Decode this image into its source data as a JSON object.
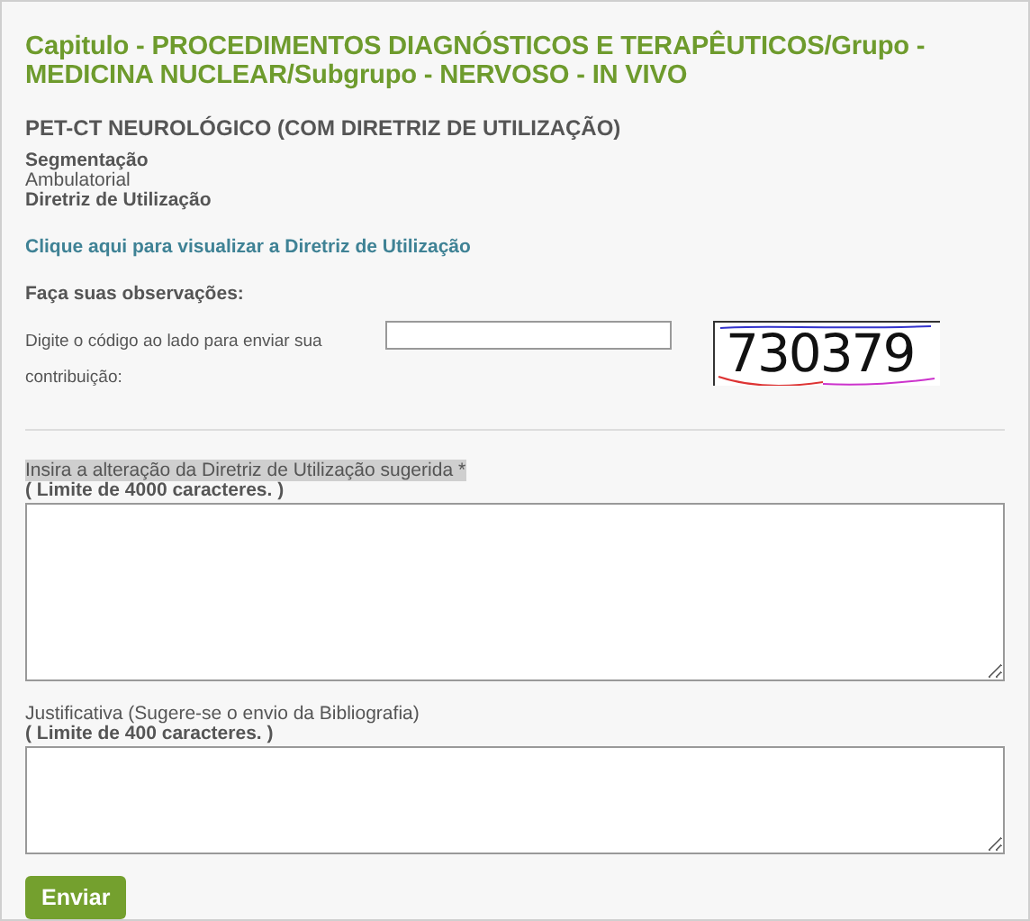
{
  "heading": "Capitulo - PROCEDIMENTOS DIAGNÓSTICOS E TERAPÊUTICOS/Grupo - MEDICINA NUCLEAR/Subgrupo - NERVOSO - IN VIVO",
  "procedure": "PET-CT NEUROLÓGICO (COM DIRETRIZ DE UTILIZAÇÃO)",
  "details": [
    {
      "kind": "label",
      "text": "Segmentação"
    },
    {
      "kind": "value",
      "text": "Ambulatorial"
    },
    {
      "kind": "label",
      "text": "Diretriz de Utilização"
    }
  ],
  "guideline_link": "Clique aqui para visualizar a Diretriz de Utilização",
  "observations_heading": "Faça suas observações:",
  "captcha": {
    "prompt": "Digite o código ao lado para enviar sua contribuição:",
    "code": "730379"
  },
  "fields": [
    {
      "label": "Insira a alteração da Diretriz de Utilização sugerida *",
      "highlighted": true,
      "limit": "( Limite de 4000 caracteres. )"
    },
    {
      "label": "Justificativa (Sugere-se o envio da Bibliografia)",
      "highlighted": false,
      "limit": "( Limite de 400 caracteres. )"
    }
  ],
  "submit": "Enviar"
}
